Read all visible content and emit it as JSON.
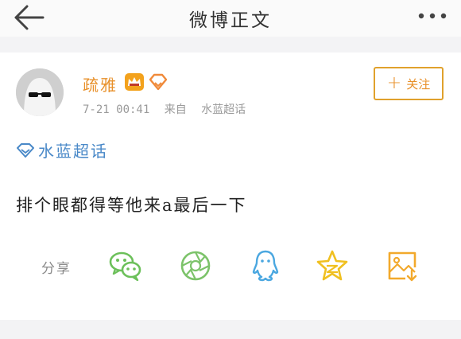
{
  "nav": {
    "title": "微博正文",
    "back_icon": "back-arrow-icon",
    "more_icon": "more-dots-icon"
  },
  "post": {
    "username": "疏雅",
    "badges": [
      "crown-badge-icon",
      "diamond-badge-icon"
    ],
    "time": "7-21 00:41",
    "source_prefix": "来自",
    "source": "水蓝超话",
    "follow_label": "关注",
    "topic": "水蓝超话",
    "content": "排个眼都得等他来a最后一下"
  },
  "share": {
    "label": "分享",
    "targets": [
      "wechat-icon",
      "moments-icon",
      "qq-icon",
      "qzone-icon",
      "save-image-icon"
    ]
  },
  "colors": {
    "accent_orange": "#e8902a",
    "link_blue": "#4a89c8",
    "share_green": "#7cc36a",
    "share_blue": "#4aa7e0",
    "share_yellow": "#f0c020"
  }
}
